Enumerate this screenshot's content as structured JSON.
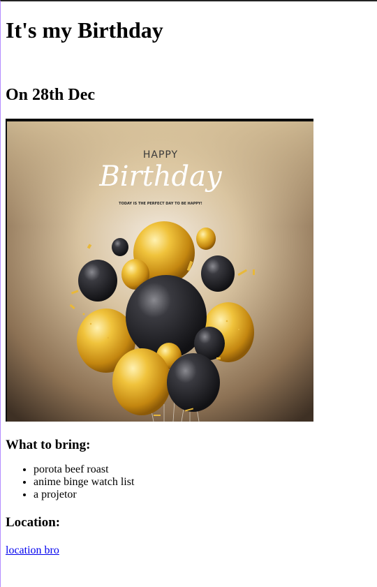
{
  "page": {
    "title": "It's my Birthday",
    "date_heading": "On 28th Dec",
    "banner": {
      "happy": "HAPPY",
      "birthday": "Birthday",
      "tagline": "TODAY IS THE PERFECT DAY TO BE HAPPY!"
    },
    "bring_heading": "What to bring:",
    "bring_items": [
      "porota beef roast",
      "anime binge watch list",
      "a projetor"
    ],
    "location_heading": "Location:",
    "location_link": "location bro"
  },
  "colors": {
    "link": "#0000ee",
    "gold": "#e0a524",
    "black_balloon": "#2a2a2e",
    "background_light": "#dccaa5",
    "background_dark": "#4a3b2c"
  }
}
